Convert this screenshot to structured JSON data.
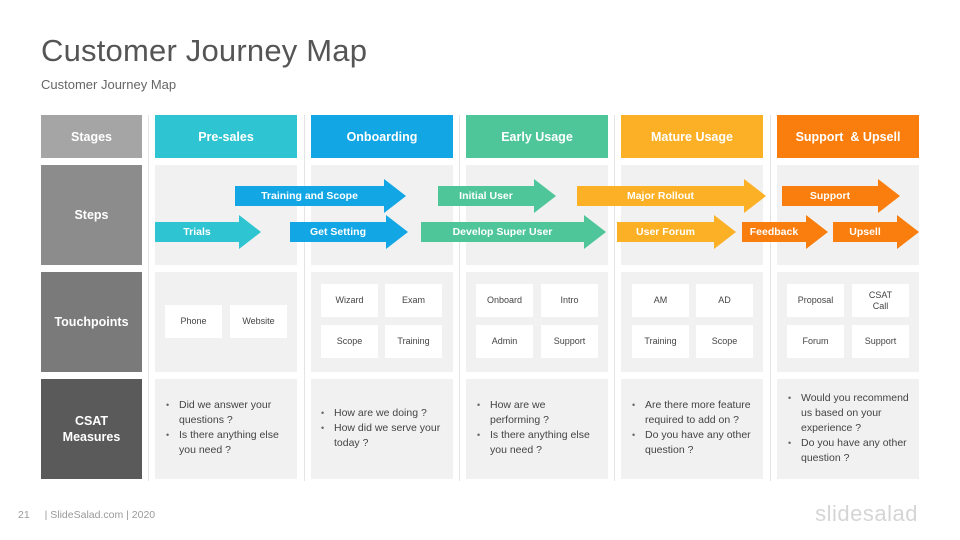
{
  "header": {
    "title": "Customer Journey Map",
    "subtitle": "Customer Journey Map"
  },
  "row_labels": {
    "stages": "Stages",
    "steps": "Steps",
    "touchpoints": "Touchpoints",
    "csat": "CSAT Measures"
  },
  "colors": {
    "presales": "#2ec4d1",
    "onboarding": "#12a6e4",
    "early_usage": "#4ec69a",
    "mature_usage": "#fbb026",
    "support_upsell": "#f97e0d",
    "row_stages": "#a5a5a5",
    "row_steps": "#8c8c8c",
    "row_touchpoints": "#7a7a7a",
    "row_csat": "#5a5a5a"
  },
  "stages": [
    {
      "label": "Pre-sales",
      "touchpoints": [
        "Phone",
        "Website"
      ],
      "csat": [
        "Did we answer your questions ?",
        "Is there anything else you need ?"
      ]
    },
    {
      "label": "Onboarding",
      "touchpoints": [
        "Wizard",
        "Exam",
        "Scope",
        "Training"
      ],
      "csat": [
        "How are we doing ?",
        "How did we serve your today ?"
      ]
    },
    {
      "label": "Early Usage",
      "touchpoints": [
        "Onboard",
        "Intro",
        "Admin",
        "Support"
      ],
      "csat": [
        "How are we performing ?",
        "Is there anything else you need ?"
      ]
    },
    {
      "label": "Mature Usage",
      "touchpoints": [
        "AM",
        "AD",
        "Training",
        "Scope"
      ],
      "csat": [
        "Are there more feature required to add on ?",
        "Do you have any other question ?"
      ]
    },
    {
      "label": "Support  & Upsell",
      "touchpoints": [
        "Proposal",
        "CSAT Call",
        "Forum",
        "Support"
      ],
      "csat": [
        "Would you recommend us based on your experience ?",
        "Do you have any other question ?"
      ]
    }
  ],
  "steps": [
    {
      "label": "Training and Scope",
      "stage": "onboarding"
    },
    {
      "label": "Trials",
      "stage": "presales"
    },
    {
      "label": "Get Setting",
      "stage": "onboarding"
    },
    {
      "label": "Initial User",
      "stage": "early_usage"
    },
    {
      "label": "Develop Super User",
      "stage": "early_usage"
    },
    {
      "label": "Major Rollout",
      "stage": "mature_usage"
    },
    {
      "label": "User Forum",
      "stage": "mature_usage"
    },
    {
      "label": "Feedback",
      "stage": "support_upsell"
    },
    {
      "label": "Support",
      "stage": "support_upsell"
    },
    {
      "label": "Upsell",
      "stage": "support_upsell"
    }
  ],
  "footer": {
    "page_number": "21",
    "credit": "| SlideSalad.com | 2020",
    "logo": "slidesalad"
  }
}
